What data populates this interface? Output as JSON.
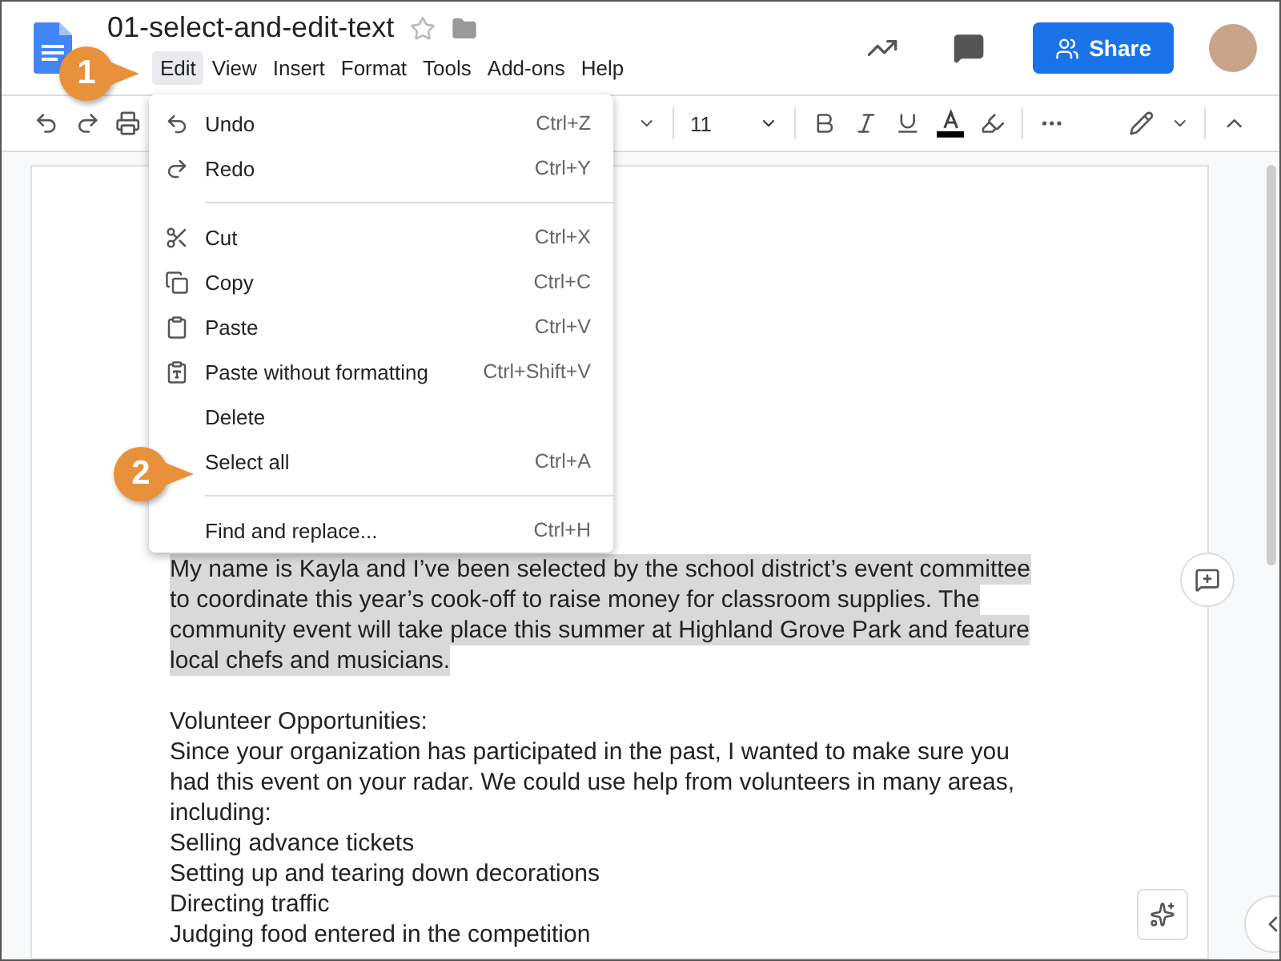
{
  "document": {
    "title": "01-select-and-edit-text",
    "starred": false
  },
  "menu_bar": [
    {
      "label": "Edit",
      "selected": true
    },
    {
      "label": "View",
      "selected": false
    },
    {
      "label": "Insert",
      "selected": false
    },
    {
      "label": "Format",
      "selected": false
    },
    {
      "label": "Tools",
      "selected": false
    },
    {
      "label": "Add-ons",
      "selected": false
    },
    {
      "label": "Help",
      "selected": false
    }
  ],
  "share_button": "Share",
  "toolbar": {
    "font_size": "11"
  },
  "edit_menu": [
    {
      "kind": "item",
      "label": "Undo",
      "shortcut": "Ctrl+Z"
    },
    {
      "kind": "item",
      "label": "Redo",
      "shortcut": "Ctrl+Y"
    },
    {
      "kind": "separator"
    },
    {
      "kind": "item",
      "label": "Cut",
      "shortcut": "Ctrl+X"
    },
    {
      "kind": "item",
      "label": "Copy",
      "shortcut": "Ctrl+C"
    },
    {
      "kind": "item",
      "label": "Paste",
      "shortcut": "Ctrl+V"
    },
    {
      "kind": "item",
      "label": "Paste without formatting",
      "shortcut": "Ctrl+Shift+V"
    },
    {
      "kind": "item",
      "label": "Delete"
    },
    {
      "kind": "item",
      "label": "Select all",
      "shortcut": "Ctrl+A"
    },
    {
      "kind": "separator"
    },
    {
      "kind": "item",
      "label": "Find and replace...",
      "shortcut": "Ctrl+H"
    }
  ],
  "callouts": [
    "1",
    "2"
  ],
  "body": [
    {
      "selected": true,
      "lines": [
        "My name is Kayla and I’ve been selected by the school district’s event committee",
        "to coordinate this year’s cook-off to raise money for classroom supplies. The",
        "community event will take place this summer at Highland Grove Park and feature",
        "local chefs and musicians."
      ]
    },
    {
      "selected": false,
      "lines": [
        "Volunteer Opportunities:",
        "Since your organization has participated in the past, I wanted to make sure you",
        "had this event on your radar. We could use help from volunteers in many areas,",
        "including:",
        "Selling advance tickets",
        "Setting up and tearing down decorations",
        "Directing traffic",
        "Judging food entered in the competition"
      ]
    }
  ]
}
